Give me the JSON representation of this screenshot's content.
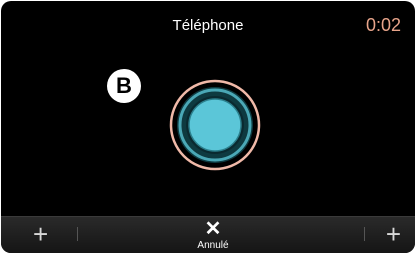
{
  "header": {
    "title": "Téléphone",
    "timer": "0:02"
  },
  "badge": "B",
  "call_button": {
    "icon": "call-circle-icon",
    "fill_color": "#5bc6d8",
    "ring_color": "#f0b9a8"
  },
  "bottom_bar": {
    "left_action": "+",
    "right_action": "+",
    "cancel_icon": "✕",
    "cancel_label": "Annulé"
  }
}
